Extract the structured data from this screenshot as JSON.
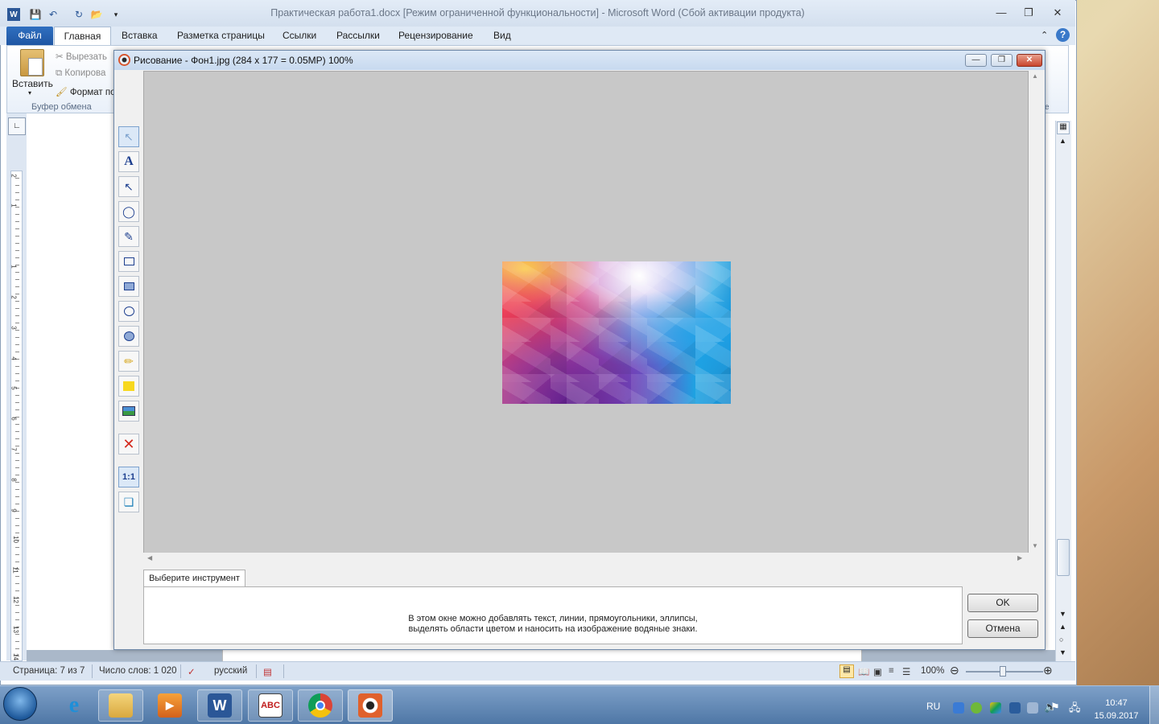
{
  "word": {
    "title": "Практическая работа1.docx [Режим ограниченной функциональности]  -  Microsoft Word (Сбой активации продукта)",
    "tabs": [
      "Файл",
      "Главная",
      "Вставка",
      "Разметка страницы",
      "Ссылки",
      "Рассылки",
      "Рецензирование",
      "Вид"
    ],
    "clipboard": {
      "paste": "Вставить",
      "cut": "Вырезать",
      "copy": "Копирова",
      "format": "Формат по",
      "group": "Буфер обмена"
    },
    "ruler_numbers": [
      "2",
      "1",
      "1",
      "2",
      "3",
      "4",
      "5",
      "6",
      "7",
      "8",
      "9",
      "10",
      "11",
      "12",
      "13",
      "14"
    ],
    "status": {
      "page": "Страница: 7 из 7",
      "words": "Число слов: 1 020",
      "lang": "русский",
      "zoom": "100%"
    }
  },
  "dialog": {
    "title": "Рисование  -  Фон1.jpg  (284 x 177 = 0.05MP)   100%",
    "tab": "Выберите инструмент",
    "hint_line1": "В этом окне можно добавлять текст, линии, прямоугольники, эллипсы,",
    "hint_line2": "выделять области цветом и наносить на изображение водяные знаки.",
    "ok": "OK",
    "cancel": "Отмена",
    "tools": [
      "select-tool",
      "text-tool",
      "arrow-tool",
      "lasso-tool",
      "pen-tool",
      "rectangle-tool",
      "filled-rectangle-tool",
      "ellipse-tool",
      "filled-ellipse-tool",
      "highlighter-tool",
      "fill-color-tool",
      "watermark-tool",
      "delete-tool",
      "actual-size-tool",
      "fit-tool"
    ],
    "actual_size_label": "1:1"
  },
  "taskbar": {
    "lang": "RU",
    "time": "10:47",
    "date": "15.09.2017",
    "abc_label": "ABC"
  },
  "colors": {
    "accent": "#1f56a3",
    "dialog_bg": "#c8c8c8"
  }
}
